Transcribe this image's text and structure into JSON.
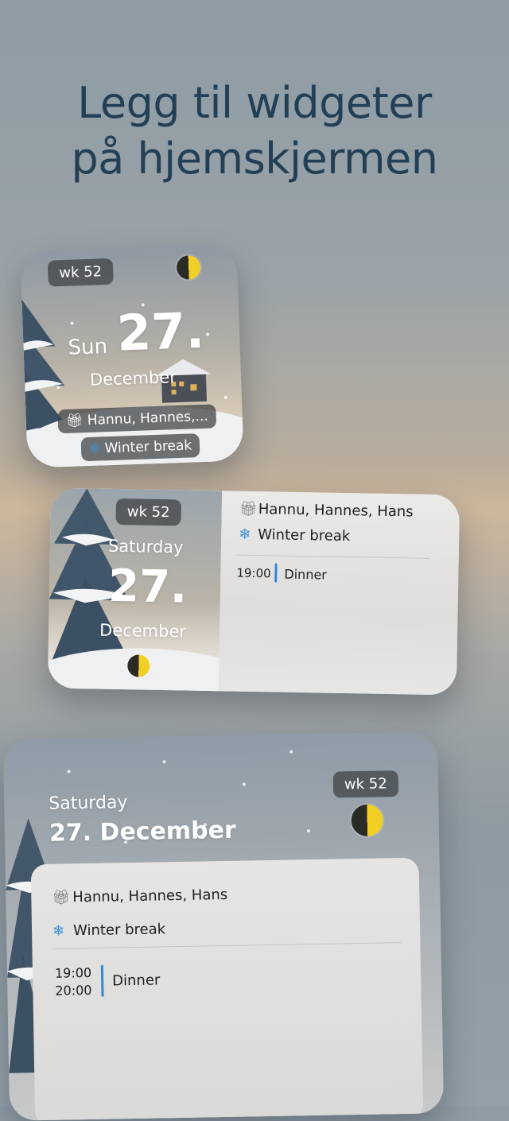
{
  "headline": {
    "line1": "Legg til widgeter",
    "line2": "på hjemskjermen"
  },
  "small_widget": {
    "week": "wk 52",
    "weekday": "Sun",
    "day": "27.",
    "month": "December",
    "birthdays": "Hannu, Hannes,...",
    "holiday": "Winter break"
  },
  "medium_widget": {
    "week": "wk 52",
    "weekday": "Saturday",
    "day": "27.",
    "month": "December",
    "birthdays": "Hannu, Hannes, Hans",
    "holiday": "Winter break",
    "event_time": "19:00",
    "event_title": "Dinner"
  },
  "large_widget": {
    "week": "wk 52",
    "weekday": "Saturday",
    "date": "27. December",
    "birthdays": "Hannu, Hannes, Hans",
    "holiday": "Winter break",
    "event_start": "19:00",
    "event_end": "20:00",
    "event_title": "Dinner"
  },
  "icons": {
    "birthday": "gift-icon",
    "holiday": "snowflake-icon",
    "moon_phase": "half-moon-icon"
  },
  "colors": {
    "headline": "#233f55",
    "event_bar": "#2f86df",
    "moon": "#f1cf24"
  }
}
